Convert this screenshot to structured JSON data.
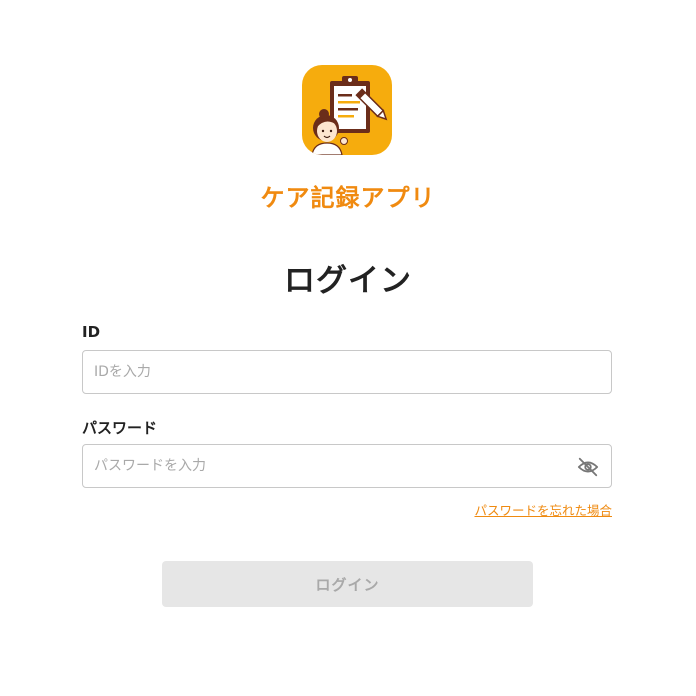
{
  "app": {
    "name": "ケア記録アプリ",
    "logo_icon": "caregiver-clipboard-icon",
    "brand_color": "#f6ac0d",
    "accent_color": "#f08a10"
  },
  "login": {
    "title": "ログイン",
    "id_label": "ID",
    "id_placeholder": "IDを入力",
    "id_value": "",
    "password_label": "パスワード",
    "password_placeholder": "パスワードを入力",
    "password_value": "",
    "password_toggle_icon": "eye-off-icon",
    "forgot_password": "パスワードを忘れた場合",
    "submit_label": "ログイン",
    "submit_state": "disabled"
  }
}
